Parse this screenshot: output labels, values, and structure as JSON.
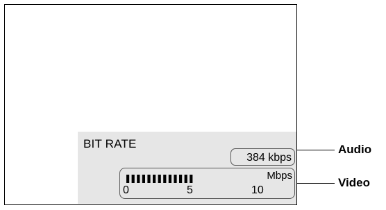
{
  "osd": {
    "title": "BIT RATE",
    "audio_value": "384 kbps",
    "video_unit": "Mbps",
    "video_scale": [
      "0",
      "5",
      "10"
    ],
    "video_level_bars": 13
  },
  "callouts": {
    "audio": "Audio",
    "video": "Video"
  }
}
